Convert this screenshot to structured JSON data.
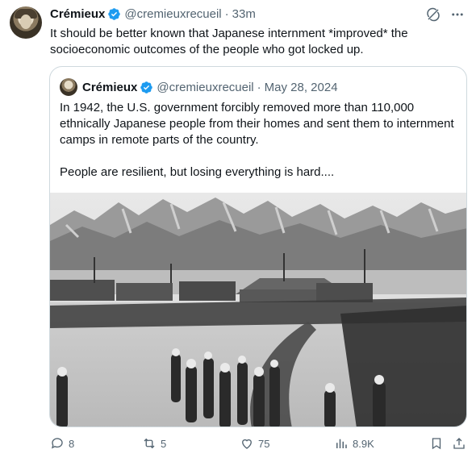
{
  "tweet": {
    "author_name": "Crémieux",
    "handle": "@cremieuxrecueil",
    "separator": "·",
    "time": "33m",
    "text": "It should be better known that Japanese internment *improved* the socioeconomic outcomes of the people who got locked up."
  },
  "quote": {
    "author_name": "Crémieux",
    "handle": "@cremieuxrecueil",
    "separator": "·",
    "date": "May 28, 2024",
    "paragraph1": "In 1942, the U.S. government forcibly removed more than 110,000 ethnically Japanese people from their homes and sent them to internment camps in remote parts of the country.",
    "paragraph2": "People are resilient, but losing everything is hard...."
  },
  "actions": {
    "replies": "8",
    "reposts": "5",
    "likes": "75",
    "views": "8.9K"
  },
  "icons": {
    "verified": "verified-badge-icon",
    "grok": "grok-icon",
    "more": "more-icon",
    "reply": "reply-icon",
    "repost": "repost-icon",
    "like": "like-icon",
    "views": "views-icon",
    "bookmark": "bookmark-icon",
    "share": "share-icon"
  },
  "colors": {
    "verified": "#1d9bf0",
    "secondary_text": "#536471",
    "border": "#cfd9de"
  }
}
